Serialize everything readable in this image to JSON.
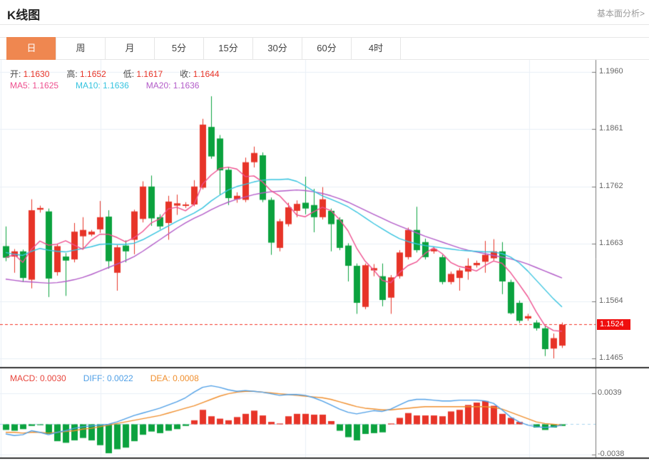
{
  "header": {
    "title": "K线图",
    "link": "基本面分析>"
  },
  "tabs": {
    "active": "日",
    "items": [
      {
        "key": "day",
        "label": "日"
      },
      {
        "key": "week",
        "label": "周"
      },
      {
        "key": "month",
        "label": "月"
      },
      {
        "key": "5min",
        "label": "5分"
      },
      {
        "key": "15min",
        "label": "15分"
      },
      {
        "key": "30min",
        "label": "30分"
      },
      {
        "key": "60min",
        "label": "60分"
      },
      {
        "key": "4hour",
        "label": "4时"
      }
    ]
  },
  "ohlc_legend": [
    {
      "key": "open",
      "label": "开:",
      "value": "1.1630"
    },
    {
      "key": "high",
      "label": "高:",
      "value": "1.1652"
    },
    {
      "key": "low",
      "label": "低:",
      "value": "1.1617"
    },
    {
      "key": "close",
      "label": "收:",
      "value": "1.1644"
    }
  ],
  "ma_legend": [
    {
      "key": "ma5",
      "label": "MA5:",
      "value": "1.1625",
      "color": "#ee4f8e"
    },
    {
      "key": "ma10",
      "label": "MA10:",
      "value": "1.1636",
      "color": "#35c3df"
    },
    {
      "key": "ma20",
      "label": "MA20:",
      "value": "1.1636",
      "color": "#b25bc8"
    }
  ],
  "macd_legend": [
    {
      "key": "macd",
      "label": "MACD:",
      "value": "0.0030",
      "color": "#e8453c"
    },
    {
      "key": "diff",
      "label": "DIFF:",
      "value": "0.0022",
      "color": "#4f9fe6"
    },
    {
      "key": "dea",
      "label": "DEA:",
      "value": "0.0008",
      "color": "#f08f2e"
    }
  ],
  "chart_data": {
    "type": "candlestick",
    "panels": [
      "price",
      "macd"
    ],
    "grid": true,
    "y_axis": {
      "ticks": [
        1.196,
        1.1861,
        1.1762,
        1.1663,
        1.1564,
        1.1465
      ]
    },
    "macd_axis": {
      "ticks": [
        0.0039,
        -0.0038
      ]
    },
    "current_price": 1.1524,
    "current_price_label": "1.1524",
    "colors": {
      "up": "#e73428",
      "down": "#0ba23e",
      "ma5": "#ee4f8e",
      "ma10": "#35c3df",
      "ma20": "#b25bc8",
      "diff": "#4f9fe6",
      "dea": "#f08f2e",
      "grid": "#e9eff6",
      "axis": "#777777",
      "price_line": "#f53326",
      "badge_bg": "#ef0e0e",
      "zero_line": "#a8d4ee",
      "divider": "#333333"
    },
    "candles": [
      [
        1.1659,
        1.1693,
        1.1633,
        1.1639
      ],
      [
        1.1641,
        1.1654,
        1.1613,
        1.165
      ],
      [
        1.165,
        1.1653,
        1.1597,
        1.1604
      ],
      [
        1.1601,
        1.174,
        1.1586,
        1.1721
      ],
      [
        1.1722,
        1.1729,
        1.1717,
        1.1725
      ],
      [
        1.1719,
        1.1724,
        1.1571,
        1.1603
      ],
      [
        1.1614,
        1.1663,
        1.1608,
        1.1659
      ],
      [
        1.1641,
        1.1647,
        1.1573,
        1.1634
      ],
      [
        1.1636,
        1.1699,
        1.1631,
        1.1684
      ],
      [
        1.1676,
        1.1709,
        1.1654,
        1.1687
      ],
      [
        1.1679,
        1.1687,
        1.1676,
        1.1684
      ],
      [
        1.1688,
        1.1737,
        1.1682,
        1.1709
      ],
      [
        1.171,
        1.1721,
        1.162,
        1.1633
      ],
      [
        1.1613,
        1.1661,
        1.1582,
        1.1657
      ],
      [
        1.166,
        1.1669,
        1.1631,
        1.165
      ],
      [
        1.167,
        1.1722,
        1.1645,
        1.1719
      ],
      [
        1.1706,
        1.1771,
        1.17,
        1.1762
      ],
      [
        1.1762,
        1.1781,
        1.1694,
        1.1707
      ],
      [
        1.1709,
        1.1714,
        1.1688,
        1.1693
      ],
      [
        1.1699,
        1.1746,
        1.167,
        1.1736
      ],
      [
        1.1729,
        1.1748,
        1.1713,
        1.1733
      ],
      [
        1.173,
        1.1735,
        1.1725,
        1.1731
      ],
      [
        1.1731,
        1.1773,
        1.1728,
        1.1762
      ],
      [
        1.176,
        1.1879,
        1.1757,
        1.1869
      ],
      [
        1.1865,
        1.1918,
        1.181,
        1.1814
      ],
      [
        1.1845,
        1.1851,
        1.1748,
        1.179
      ],
      [
        1.1791,
        1.1796,
        1.173,
        1.1742
      ],
      [
        1.174,
        1.1752,
        1.1734,
        1.1746
      ],
      [
        1.1739,
        1.1812,
        1.1735,
        1.1804
      ],
      [
        1.1804,
        1.1831,
        1.1795,
        1.182
      ],
      [
        1.1816,
        1.1821,
        1.1735,
        1.1739
      ],
      [
        1.1739,
        1.1743,
        1.1644,
        1.1665
      ],
      [
        1.1656,
        1.1706,
        1.165,
        1.1702
      ],
      [
        1.1697,
        1.1734,
        1.1693,
        1.1726
      ],
      [
        1.172,
        1.1738,
        1.1709,
        1.1732
      ],
      [
        1.1734,
        1.1779,
        1.1714,
        1.1724
      ],
      [
        1.173,
        1.1758,
        1.1683,
        1.1709
      ],
      [
        1.1709,
        1.1761,
        1.1705,
        1.174
      ],
      [
        1.172,
        1.1724,
        1.165,
        1.1697
      ],
      [
        1.1705,
        1.1709,
        1.1652,
        1.1656
      ],
      [
        1.166,
        1.1664,
        1.1598,
        1.1625
      ],
      [
        1.1625,
        1.1629,
        1.1542,
        1.1561
      ],
      [
        1.1554,
        1.1629,
        1.155,
        1.1626
      ],
      [
        1.1617,
        1.1628,
        1.1607,
        1.1621
      ],
      [
        1.1607,
        1.1629,
        1.1555,
        1.1566
      ],
      [
        1.157,
        1.1609,
        1.1542,
        1.1605
      ],
      [
        1.1607,
        1.1652,
        1.1603,
        1.1648
      ],
      [
        1.164,
        1.1691,
        1.1636,
        1.1687
      ],
      [
        1.1687,
        1.1727,
        1.1648,
        1.1652
      ],
      [
        1.1666,
        1.1672,
        1.1636,
        1.164
      ],
      [
        1.165,
        1.1658,
        1.1646,
        1.1654
      ],
      [
        1.164,
        1.1644,
        1.1593,
        1.1597
      ],
      [
        1.1597,
        1.1615,
        1.1593,
        1.1611
      ],
      [
        1.1604,
        1.1621,
        1.1582,
        1.1617
      ],
      [
        1.1615,
        1.1638,
        1.1601,
        1.1625
      ],
      [
        1.1626,
        1.1634,
        1.1622,
        1.163
      ],
      [
        1.1632,
        1.1668,
        1.1613,
        1.1644
      ],
      [
        1.1638,
        1.1671,
        1.1634,
        1.165
      ],
      [
        1.165,
        1.1666,
        1.1576,
        1.1598
      ],
      [
        1.1597,
        1.1601,
        1.1541,
        1.1543
      ],
      [
        1.1561,
        1.1565,
        1.1526,
        1.153
      ],
      [
        1.1534,
        1.1542,
        1.153,
        1.1538
      ],
      [
        1.1527,
        1.1531,
        1.1513,
        1.1517
      ],
      [
        1.1517,
        1.1521,
        1.1469,
        1.1481
      ],
      [
        1.1482,
        1.1508,
        1.1465,
        1.15
      ],
      [
        1.1487,
        1.1527,
        1.1483,
        1.1523
      ]
    ],
    "ma10": [
      1.1648,
      1.1645,
      1.1643,
      1.165,
      1.1655,
      1.1652,
      1.165,
      1.1649,
      1.1652,
      1.1655,
      1.1658,
      1.1662,
      1.1663,
      1.1662,
      1.1662,
      1.1664,
      1.167,
      1.1678,
      1.1686,
      1.1694,
      1.1702,
      1.1709,
      1.1716,
      1.1725,
      1.1737,
      1.1747,
      1.1756,
      1.1762,
      1.1766,
      1.177,
      1.1773,
      1.1774,
      1.1774,
      1.1775,
      1.1771,
      1.1763,
      1.1754,
      1.1746,
      1.174,
      1.1734,
      1.1727,
      1.1718,
      1.1708,
      1.1698,
      1.1689,
      1.168,
      1.1672,
      1.1667,
      1.1663,
      1.166,
      1.1658,
      1.1656,
      1.1654,
      1.1652,
      1.1651,
      1.165,
      1.1649,
      1.1649,
      1.1646,
      1.164,
      1.163,
      1.1616,
      1.16,
      1.1584,
      1.1568,
      1.1554
    ],
    "ma20": [
      1.1602,
      1.16,
      1.1598,
      1.1597,
      1.1596,
      1.1595,
      1.1596,
      1.1598,
      1.1601,
      1.1605,
      1.161,
      1.1616,
      1.1622,
      1.1628,
      1.1634,
      1.1641,
      1.165,
      1.166,
      1.167,
      1.168,
      1.169,
      1.1699,
      1.1707,
      1.1714,
      1.1722,
      1.1729,
      1.1735,
      1.174,
      1.1744,
      1.1748,
      1.1751,
      1.1753,
      1.1754,
      1.1755,
      1.1756,
      1.1755,
      1.1753,
      1.175,
      1.1746,
      1.1741,
      1.1735,
      1.1728,
      1.1721,
      1.1714,
      1.1707,
      1.17,
      1.1694,
      1.1688,
      1.1682,
      1.1676,
      1.1671,
      1.1666,
      1.1661,
      1.1656,
      1.1652,
      1.1649,
      1.1646,
      1.1643,
      1.164,
      1.1637,
      1.1633,
      1.1628,
      1.1622,
      1.1616,
      1.161,
      1.1604
    ],
    "macd": {
      "bars": [
        -0.0007,
        -0.0008,
        -0.0006,
        -0.0002,
        -0.0001,
        -0.0012,
        -0.0021,
        -0.0023,
        -0.002,
        -0.0017,
        -0.002,
        -0.0026,
        -0.0036,
        -0.0031,
        -0.0029,
        -0.0021,
        -0.0013,
        -0.0009,
        -0.0011,
        -0.0008,
        -0.0006,
        -0.0002,
        0.0005,
        0.0018,
        0.001,
        0.0007,
        0.0005,
        0.0009,
        0.0013,
        0.0017,
        0.0011,
        0.0003,
        0.0001,
        0.001,
        0.0013,
        0.0013,
        0.0012,
        0.0012,
        0.0004,
        -0.0008,
        -0.0016,
        -0.002,
        -0.0012,
        -0.0011,
        -0.001,
        0.0001,
        0.0008,
        0.0014,
        0.0011,
        0.0011,
        0.0011,
        0.001,
        0.0016,
        0.0018,
        0.0024,
        0.0027,
        0.0029,
        0.0023,
        0.0013,
        0.0008,
        0.0003,
        0.0,
        -0.0004,
        -0.0007,
        -0.0004,
        -0.0002
      ],
      "diff": [
        -0.0012,
        -0.0014,
        -0.0013,
        -0.0008,
        -0.001,
        -0.0013,
        -0.001,
        -0.0008,
        -0.0005,
        -0.0003,
        -0.0002,
        -0.0001,
        0.0,
        0.0003,
        0.0007,
        0.0011,
        0.0014,
        0.0017,
        0.002,
        0.0024,
        0.0028,
        0.0033,
        0.004,
        0.0046,
        0.0048,
        0.0046,
        0.0043,
        0.0041,
        0.0042,
        0.0041,
        0.004,
        0.0038,
        0.0036,
        0.0037,
        0.0037,
        0.0036,
        0.0033,
        0.0029,
        0.0024,
        0.0019,
        0.0015,
        0.0013,
        0.0015,
        0.0017,
        0.0016,
        0.0019,
        0.0024,
        0.0029,
        0.0031,
        0.0031,
        0.003,
        0.0029,
        0.0029,
        0.003,
        0.003,
        0.003,
        0.0029,
        0.0026,
        0.0018,
        0.0009,
        0.0003,
        -0.0001,
        -0.0003,
        -0.0004,
        -0.0003,
        -0.0001
      ],
      "dea": [
        -0.001,
        -0.001,
        -0.0011,
        -0.001,
        -0.001,
        -0.0011,
        -0.001,
        -0.0009,
        -0.0008,
        -0.0006,
        -0.0005,
        -0.0003,
        -0.0001,
        0.0001,
        0.0003,
        0.0005,
        0.0007,
        0.0009,
        0.0011,
        0.0014,
        0.0017,
        0.002,
        0.0023,
        0.0027,
        0.0031,
        0.0035,
        0.0038,
        0.004,
        0.0041,
        0.0041,
        0.004,
        0.0039,
        0.0038,
        0.0037,
        0.0036,
        0.0035,
        0.0034,
        0.0033,
        0.0031,
        0.0028,
        0.0025,
        0.0022,
        0.002,
        0.0019,
        0.0018,
        0.0018,
        0.0019,
        0.002,
        0.0021,
        0.0022,
        0.0022,
        0.0022,
        0.0022,
        0.0022,
        0.0022,
        0.0022,
        0.0022,
        0.0021,
        0.0019,
        0.0015,
        0.0011,
        0.0007,
        0.0003,
        0.0001,
        0.0,
        -0.0001
      ]
    }
  }
}
